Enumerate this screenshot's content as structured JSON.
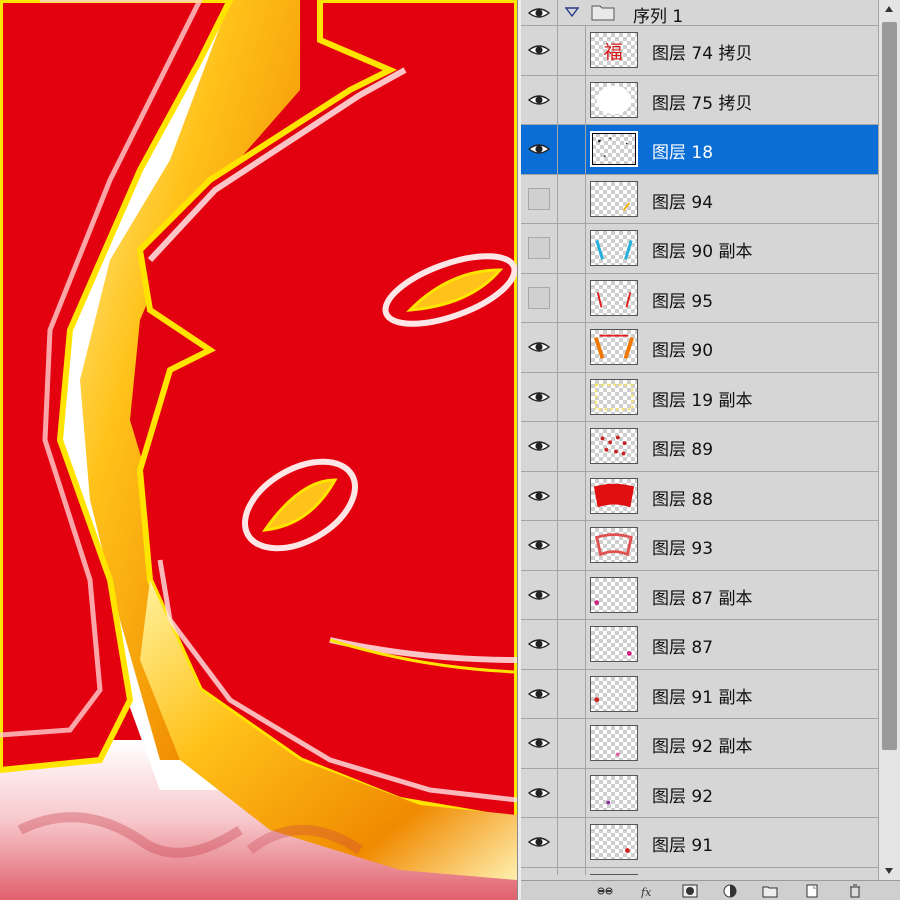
{
  "layers_panel": {
    "group": {
      "name": "序列 1",
      "visible": true,
      "expanded": true,
      "icon": "folder-icon"
    },
    "layers": [
      {
        "name": "图层 74 拷贝",
        "visible": true,
        "selected": false,
        "thumb": "fu-character"
      },
      {
        "name": "图层 75 拷贝",
        "visible": true,
        "selected": false,
        "thumb": "white-blob"
      },
      {
        "name": "图层 18",
        "visible": true,
        "selected": true,
        "thumb": "dots"
      },
      {
        "name": "图层 94",
        "visible": false,
        "selected": false,
        "thumb": "yellow-stroke"
      },
      {
        "name": "图层 90 副本",
        "visible": false,
        "selected": false,
        "thumb": "cyan-brackets"
      },
      {
        "name": "图层 95",
        "visible": false,
        "selected": false,
        "thumb": "red-brackets"
      },
      {
        "name": "图层 90",
        "visible": true,
        "selected": false,
        "thumb": "orange-brackets"
      },
      {
        "name": "图层 19 副本",
        "visible": true,
        "selected": false,
        "thumb": "yellow-frame"
      },
      {
        "name": "图层 89",
        "visible": true,
        "selected": false,
        "thumb": "red-pattern"
      },
      {
        "name": "图层 88",
        "visible": true,
        "selected": false,
        "thumb": "red-fan"
      },
      {
        "name": "图层 93",
        "visible": true,
        "selected": false,
        "thumb": "red-outline"
      },
      {
        "name": "图层 87 副本",
        "visible": true,
        "selected": false,
        "thumb": "small-flower-left"
      },
      {
        "name": "图层 87",
        "visible": true,
        "selected": false,
        "thumb": "small-flower-right"
      },
      {
        "name": "图层 91 副本",
        "visible": true,
        "selected": false,
        "thumb": "small-red-left"
      },
      {
        "name": "图层 92 副本",
        "visible": true,
        "selected": false,
        "thumb": "small-pink-mid"
      },
      {
        "name": "图层 92",
        "visible": true,
        "selected": false,
        "thumb": "small-purple-mid"
      },
      {
        "name": "图层 91",
        "visible": true,
        "selected": false,
        "thumb": "small-red-right"
      },
      {
        "name": "",
        "visible": true,
        "selected": false,
        "thumb": "partial"
      }
    ],
    "toolbar_icons": [
      "link-layers-icon",
      "fx-icon",
      "add-mask-icon",
      "adjustment-layer-icon",
      "new-group-icon",
      "new-layer-icon",
      "delete-layer-icon"
    ]
  },
  "colors": {
    "selection": "#0a6ed6",
    "panel_bg": "#d6d6d6",
    "canvas_red": "#e00010",
    "canvas_gold": "#f5a400"
  }
}
